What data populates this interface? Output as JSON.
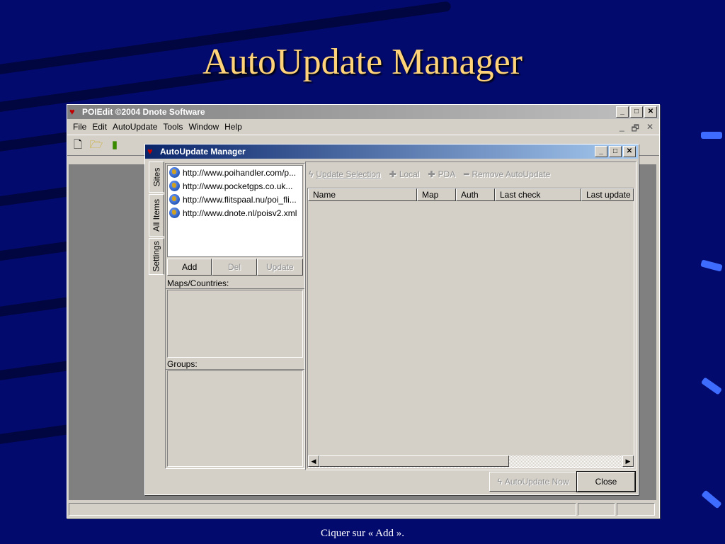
{
  "slide": {
    "title": "AutoUpdate Manager",
    "caption": "Ciquer sur « Add »."
  },
  "app": {
    "title": "POIEdit ©2004 Dnote Software",
    "menu": [
      "File",
      "Edit",
      "AutoUpdate",
      "Tools",
      "Window",
      "Help"
    ],
    "mdi_controls": [
      "_",
      "🗗",
      "✕"
    ]
  },
  "dialog": {
    "title": "AutoUpdate Manager",
    "tabs": [
      "Sites",
      "All Items",
      "Settings"
    ],
    "sites": [
      "http://www.poihandler.com/p...",
      "http://www.pocketgps.co.uk...",
      "http://www.flitspaal.nu/poi_fli...",
      "http://www.dnote.nl/poisv2.xml"
    ],
    "buttons": {
      "add": "Add",
      "del": "Del",
      "update": "Update"
    },
    "maps_label": "Maps/Countries:",
    "groups_label": "Groups:",
    "toolbar": {
      "update_selection": "Update Selection",
      "local": "Local",
      "pda": "PDA",
      "remove": "Remove AutoUpdate"
    },
    "columns": [
      "Name",
      "Map",
      "Auth",
      "Last check",
      "Last update"
    ],
    "footer": {
      "autoupdate_now": "AutoUpdate Now",
      "close": "Close"
    }
  },
  "icons": [
    "app-icon",
    "new-file-icon",
    "open-folder-icon",
    "battery-icon",
    "globe-icon",
    "lightning-icon",
    "plus-icon",
    "minus-icon"
  ]
}
